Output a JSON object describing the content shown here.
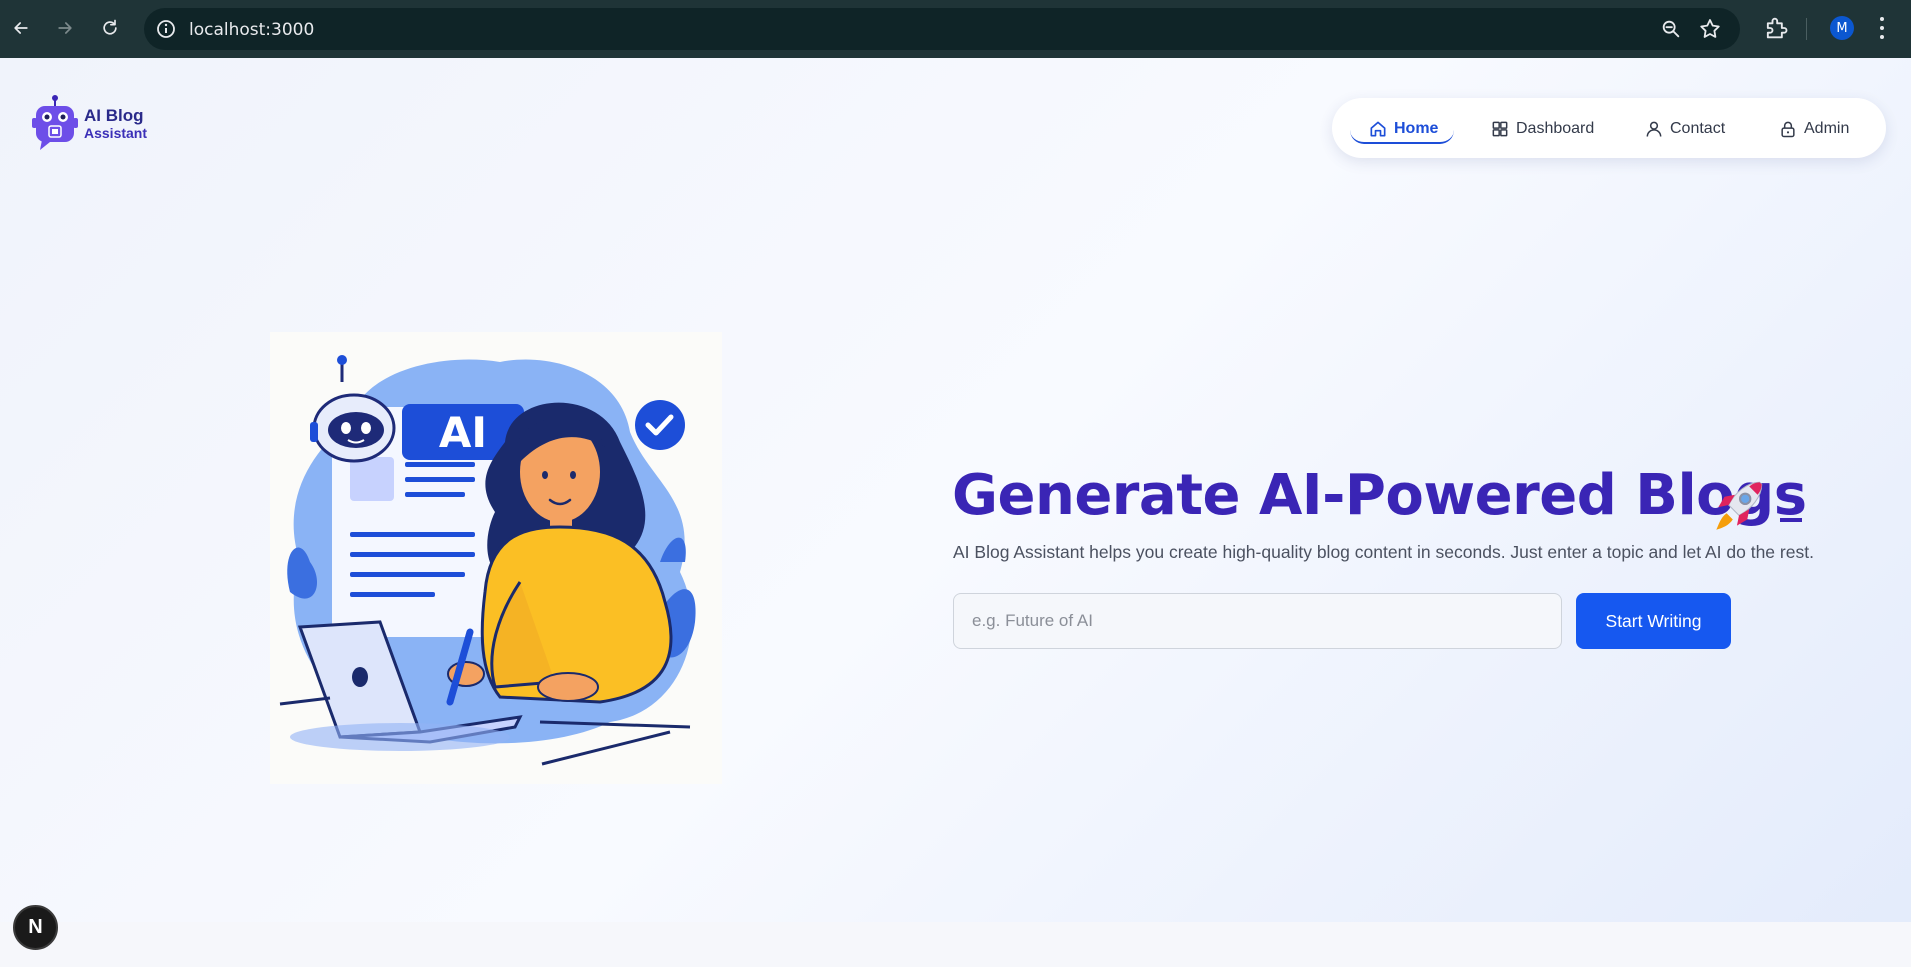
{
  "browser": {
    "url": "localhost:3000",
    "profile_initial": "M"
  },
  "brand": {
    "line1": "AI Blog",
    "line2": "Assistant",
    "color": "#3a25b5"
  },
  "nav": {
    "items": [
      {
        "label": "Home",
        "icon": "home-icon",
        "active": true
      },
      {
        "label": "Dashboard",
        "icon": "dashboard-icon",
        "active": false
      },
      {
        "label": "Contact",
        "icon": "user-icon",
        "active": false
      },
      {
        "label": "Admin",
        "icon": "lock-icon",
        "active": false
      }
    ]
  },
  "hero": {
    "headline": "Generate AI-Powered Blogs",
    "subtitle": "AI Blog Assistant helps you create high-quality blog content in seconds. Just enter a topic and let AI do the rest.",
    "input_placeholder": "e.g. Future of AI",
    "input_value": "",
    "cta_label": "Start Writing",
    "illustration_label": "AI"
  },
  "dev_badge": "N",
  "colors": {
    "accent": "#1658f0",
    "headline": "#3a25b5",
    "chrome": "#1f3437"
  }
}
